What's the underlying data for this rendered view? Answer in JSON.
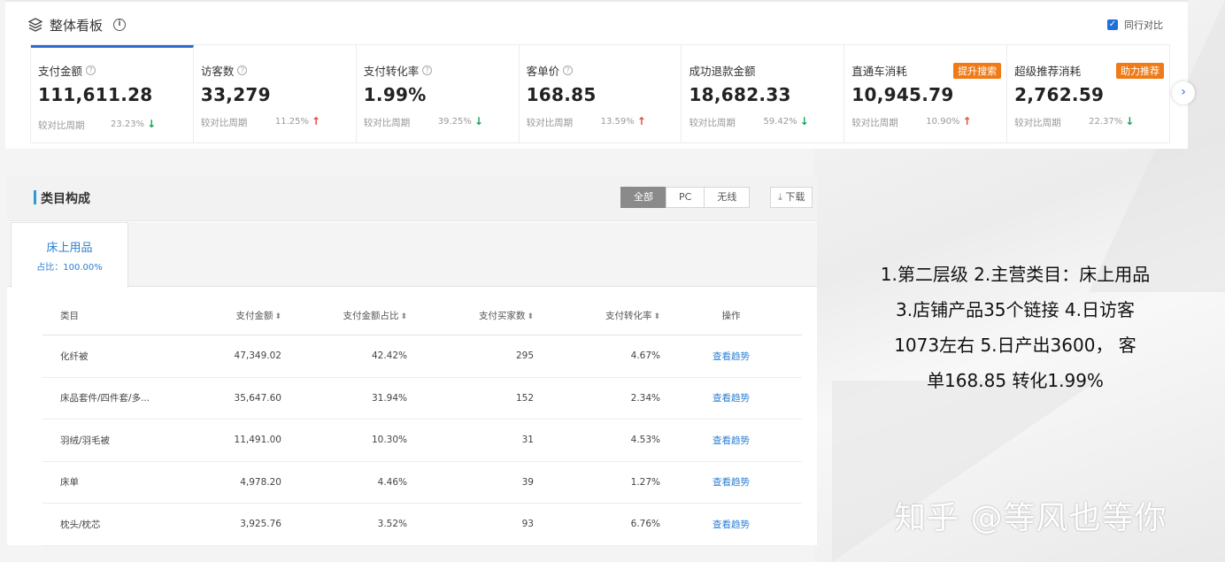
{
  "dashboard": {
    "title": "整体看板",
    "peer_compare_label": "同行对比",
    "compare_label": "较对比周期",
    "metrics": [
      {
        "label": "支付金额",
        "value": "111,611.28",
        "change": "23.23%",
        "direction": "down",
        "has_help": true,
        "badge": ""
      },
      {
        "label": "访客数",
        "value": "33,279",
        "change": "11.25%",
        "direction": "up",
        "has_help": true,
        "badge": ""
      },
      {
        "label": "支付转化率",
        "value": "1.99%",
        "change": "39.25%",
        "direction": "down",
        "has_help": true,
        "badge": ""
      },
      {
        "label": "客单价",
        "value": "168.85",
        "change": "13.59%",
        "direction": "up",
        "has_help": true,
        "badge": ""
      },
      {
        "label": "成功退款金额",
        "value": "18,682.33",
        "change": "59.42%",
        "direction": "down",
        "has_help": false,
        "badge": ""
      },
      {
        "label": "直通车消耗",
        "value": "10,945.79",
        "change": "10.90%",
        "direction": "up",
        "has_help": false,
        "badge": "提升搜索"
      },
      {
        "label": "超级推荐消耗",
        "value": "2,762.59",
        "change": "22.37%",
        "direction": "down",
        "has_help": false,
        "badge": "助力推荐"
      }
    ]
  },
  "category": {
    "title": "类目构成",
    "segments": [
      "全部",
      "PC",
      "无线"
    ],
    "download_label": "下载",
    "tab": {
      "name": "床上用品",
      "share": "占比：100.00%"
    },
    "columns": [
      "类目",
      "支付金额",
      "支付金额占比",
      "支付买家数",
      "支付转化率",
      "操作"
    ],
    "rows": [
      {
        "name": "化纤被",
        "amount": "47,349.02",
        "share": "42.42%",
        "buyers": "295",
        "conversion": "4.67%",
        "action": "查看趋势"
      },
      {
        "name": "床品套件/四件套/多...",
        "amount": "35,647.60",
        "share": "31.94%",
        "buyers": "152",
        "conversion": "2.34%",
        "action": "查看趋势"
      },
      {
        "name": "羽绒/羽毛被",
        "amount": "11,491.00",
        "share": "10.30%",
        "buyers": "31",
        "conversion": "4.53%",
        "action": "查看趋势"
      },
      {
        "name": "床单",
        "amount": "4,978.20",
        "share": "4.46%",
        "buyers": "39",
        "conversion": "1.27%",
        "action": "查看趋势"
      },
      {
        "name": "枕头/枕芯",
        "amount": "3,925.76",
        "share": "3.52%",
        "buyers": "93",
        "conversion": "6.76%",
        "action": "查看趋势"
      }
    ]
  },
  "annotation": {
    "lines": [
      "1.第二层级 2.主营类目：床上用品",
      "3.店铺产品35个链接 4.日访客",
      "1073左右 5.日产出3600， 客",
      "单168.85 转化1.99%"
    ]
  },
  "watermark": "知乎 @等风也等你",
  "colors": {
    "accent": "#2a6bd6",
    "badge": "#f07b16",
    "down": "#1aa05a",
    "up": "#e04a3a",
    "link": "#2a7fd4"
  }
}
